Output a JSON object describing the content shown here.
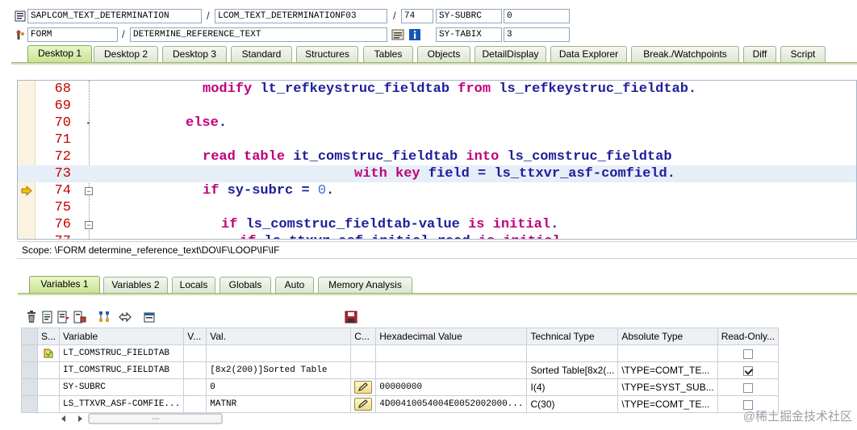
{
  "header": {
    "row1": {
      "program": "SAPLCOM_TEXT_DETERMINATION",
      "include": "LCOM_TEXT_DETERMINATIONF03",
      "line": "74",
      "field_name": "SY-SUBRC",
      "field_value": "0"
    },
    "row2": {
      "type": "FORM",
      "name": "DETERMINE_REFERENCE_TEXT",
      "field_name": "SY-TABIX",
      "field_value": "3"
    },
    "separator": "/"
  },
  "desktop_tabs": [
    "Desktop 1",
    "Desktop 2",
    "Desktop 3",
    "Standard",
    "Structures",
    "Tables",
    "Objects",
    "DetailDisplay",
    "Data Explorer",
    "Break./Watchpoints",
    "Diff",
    "Script"
  ],
  "code": {
    "lines": [
      {
        "n": "68",
        "segs": [
          [
            "kw",
            "modify "
          ],
          [
            "id",
            "lt_refkeystruc_fieldtab "
          ],
          [
            "kw",
            "from "
          ],
          [
            "id",
            "ls_refkeystruc_fieldtab"
          ],
          [
            "pt",
            "."
          ]
        ]
      },
      {
        "n": "69",
        "segs": []
      },
      {
        "n": "70",
        "segs": [
          [
            "kw",
            "else"
          ],
          [
            "pt",
            "."
          ]
        ]
      },
      {
        "n": "71",
        "segs": []
      },
      {
        "n": "72",
        "segs": [
          [
            "kw",
            "read table "
          ],
          [
            "id",
            "it_comstruc_fieldtab "
          ],
          [
            "kw",
            "into "
          ],
          [
            "id",
            "ls_comstruc_fieldtab"
          ]
        ]
      },
      {
        "n": "73",
        "segs": [
          [
            "kw",
            "with key "
          ],
          [
            "id",
            "field "
          ],
          [
            "pt",
            "= "
          ],
          [
            "id",
            "ls_ttxvr_asf-comfield"
          ],
          [
            "pt",
            "."
          ]
        ]
      },
      {
        "n": "74",
        "segs": [
          [
            "kw",
            "if "
          ],
          [
            "id",
            "sy-subrc "
          ],
          [
            "pt",
            "= "
          ],
          [
            "num",
            "0"
          ],
          [
            "pt",
            "."
          ]
        ]
      },
      {
        "n": "75",
        "segs": []
      },
      {
        "n": "76",
        "segs": [
          [
            "kw",
            "if "
          ],
          [
            "id",
            "ls_comstruc_fieldtab-value "
          ],
          [
            "kw",
            "is initial"
          ],
          [
            "pt",
            "."
          ]
        ]
      },
      {
        "n": "77",
        "segs": [
          [
            "kw",
            "if "
          ],
          [
            "id",
            "ls_ttxvr_asf-initial_read "
          ],
          [
            "kw",
            "is initial"
          ]
        ]
      }
    ],
    "scope_label": "Scope: \\FORM determine_reference_text\\DO\\IF\\LOOP\\IF\\IF"
  },
  "var_tabs": [
    "Variables 1",
    "Variables 2",
    "Locals",
    "Globals",
    "Auto",
    "Memory Analysis"
  ],
  "grid": {
    "headers": [
      "S...",
      "Variable",
      "V...",
      "Val.",
      "C...",
      "Hexadecimal Value",
      "Technical Type",
      "Absolute Type",
      "Read-Only..."
    ],
    "rows": [
      {
        "variable": "LT_COMSTRUC_FIELDTAB",
        "value": "",
        "hex": "",
        "tech": "",
        "abs": "",
        "readonly": false,
        "editable": false
      },
      {
        "variable": "IT_COMSTRUC_FIELDTAB",
        "value": "[8x2(200)]Sorted Table",
        "hex": "",
        "tech": "Sorted Table[8x2(...",
        "abs": "\\TYPE=COMT_TE...",
        "readonly": true,
        "editable": false
      },
      {
        "variable": "SY-SUBRC",
        "value": "0",
        "hex": "00000000",
        "tech": "I(4)",
        "abs": "\\TYPE=SYST_SUB...",
        "readonly": false,
        "editable": true
      },
      {
        "variable": "LS_TTXVR_ASF-COMFIE...",
        "value": "MATNR",
        "hex": "4D00410054004E0052002000...",
        "tech": "C(30)",
        "abs": "\\TYPE=COMT_TE...",
        "readonly": false,
        "editable": true
      }
    ]
  },
  "watermark": "@稀土掘金技术社区",
  "colors": {
    "keyword": "#c0007a",
    "identifier": "#1e1e9a",
    "line_number": "#c40000",
    "number": "#3a6fd8"
  }
}
